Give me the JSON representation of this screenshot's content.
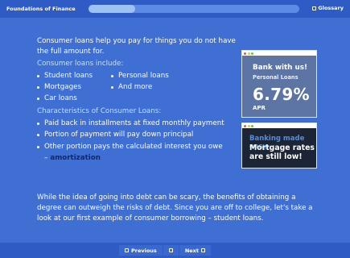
{
  "header": {
    "course_title": "Foundations of Finance",
    "progress_fraction": 0.22,
    "glossary_label": "Glossary",
    "glossary_icon": "box-icon"
  },
  "lesson": {
    "intro": "Consumer loans help you pay for things you do not have the full amount for.",
    "types_heading": "Consumer loans include:",
    "types": [
      "Student loans",
      "Personal loans",
      "Mortgages",
      "And more",
      "Car loans"
    ],
    "characteristics_heading": "Characteristics of Consumer Loans:",
    "characteristics": [
      "Paid back in installments at fixed monthly payment",
      "Portion of payment will pay down principal",
      "Other portion pays the calculated interest you owe"
    ],
    "amortization_dash": "–",
    "amortization_term": "amortization",
    "closing": "While the idea of going into debt can be scary, the benefits of obtaining a degree can outweigh the risks of debt. Since you are off to college, let's take a look at our first example of consumer borrowing – student loans."
  },
  "ads": {
    "bank": {
      "title": "Bank with us!",
      "subtitle": "Personal Loans",
      "rate": "6.79%",
      "rate_label": "APR"
    },
    "mortgage": {
      "tagline": "Banking made easy.",
      "headline": "Mortgage rates are still low!"
    },
    "window_dot_colors": [
      "#e05a4e",
      "#f0c24b",
      "#62c654"
    ]
  },
  "footer": {
    "previous_label": "Previous",
    "next_label": "Next"
  },
  "colors": {
    "background": "#3f6fd3",
    "bar": "#2f5cc4",
    "accent_text": "#bfe0ff",
    "term_text": "#14285e"
  }
}
